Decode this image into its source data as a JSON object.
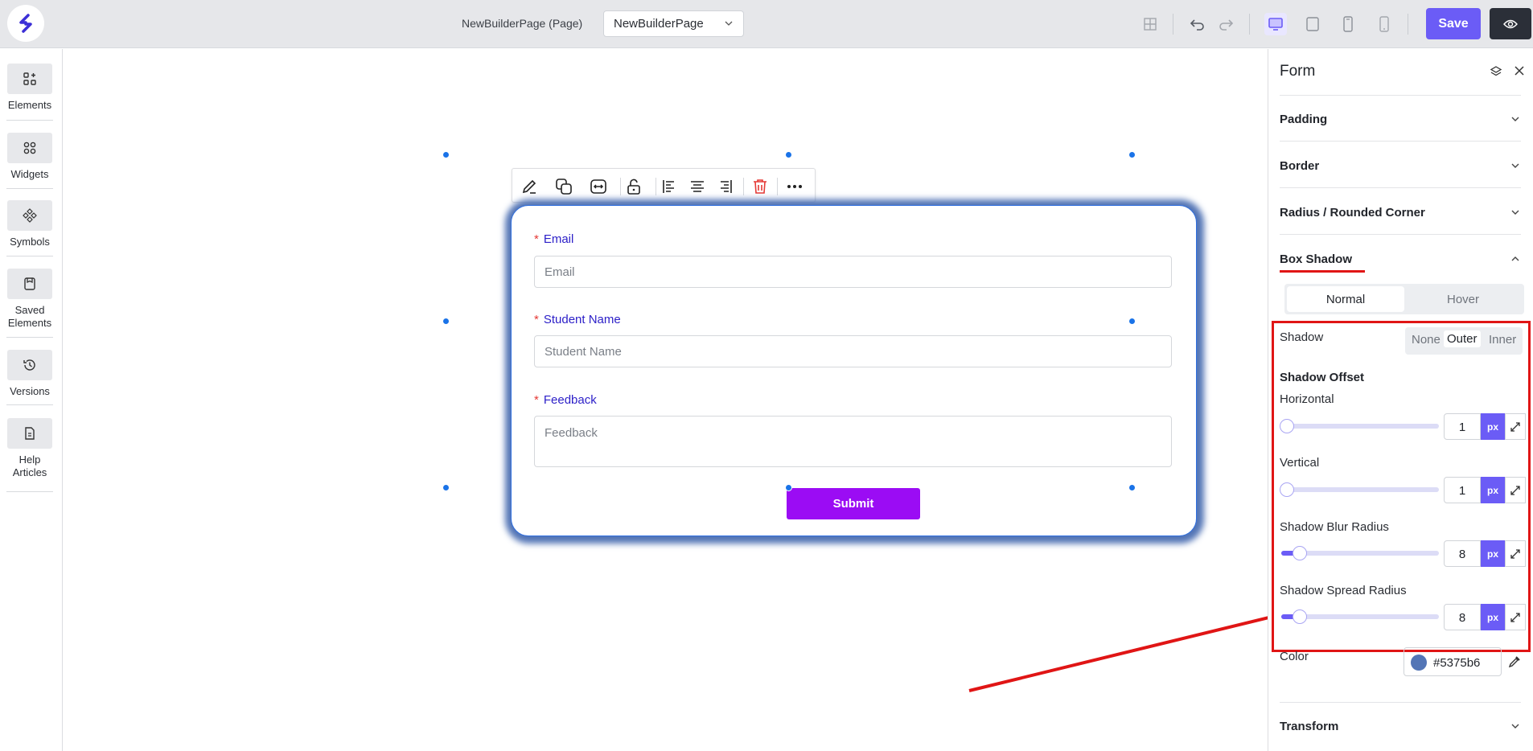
{
  "topbar": {
    "page_label": "NewBuilderPage (Page)",
    "page_select_value": "NewBuilderPage",
    "save_label": "Save"
  },
  "sidebar": {
    "items": [
      {
        "label": "Elements",
        "icon": "elements-icon"
      },
      {
        "label": "Widgets",
        "icon": "widgets-icon"
      },
      {
        "label": "Symbols",
        "icon": "symbols-icon"
      },
      {
        "label": "Saved Elements",
        "icon": "saved-elements-icon"
      },
      {
        "label": "Versions",
        "icon": "versions-icon"
      },
      {
        "label": "Help Articles",
        "icon": "help-articles-icon"
      }
    ]
  },
  "form": {
    "fields": [
      {
        "label": "Email",
        "placeholder": "Email"
      },
      {
        "label": "Student Name",
        "placeholder": "Student Name"
      },
      {
        "label": "Feedback",
        "placeholder": "Feedback"
      }
    ],
    "required_mark": "*",
    "submit_label": "Submit"
  },
  "panel": {
    "title": "Form",
    "sections": {
      "padding": "Padding",
      "border": "Border",
      "radius": "Radius / Rounded Corner",
      "box_shadow": "Box Shadow",
      "transform": "Transform"
    },
    "state_tabs": {
      "normal": "Normal",
      "hover": "Hover"
    },
    "shadow": {
      "label": "Shadow",
      "options": {
        "none": "None",
        "outer": "Outer",
        "inner": "Inner"
      },
      "selected": "Outer",
      "offset_heading": "Shadow Offset",
      "horizontal": {
        "label": "Horizontal",
        "value": "1",
        "unit": "px"
      },
      "vertical": {
        "label": "Vertical",
        "value": "1",
        "unit": "px"
      },
      "blur": {
        "label": "Shadow Blur Radius",
        "value": "8",
        "unit": "px"
      },
      "spread": {
        "label": "Shadow Spread Radius",
        "value": "8",
        "unit": "px"
      },
      "color_label": "Color",
      "color_value": "#5375b6"
    }
  },
  "colors": {
    "accent": "#6b5cf6",
    "submit": "#9b0cf4",
    "annotation_red": "#e01515",
    "shadow": "#5375b6"
  }
}
